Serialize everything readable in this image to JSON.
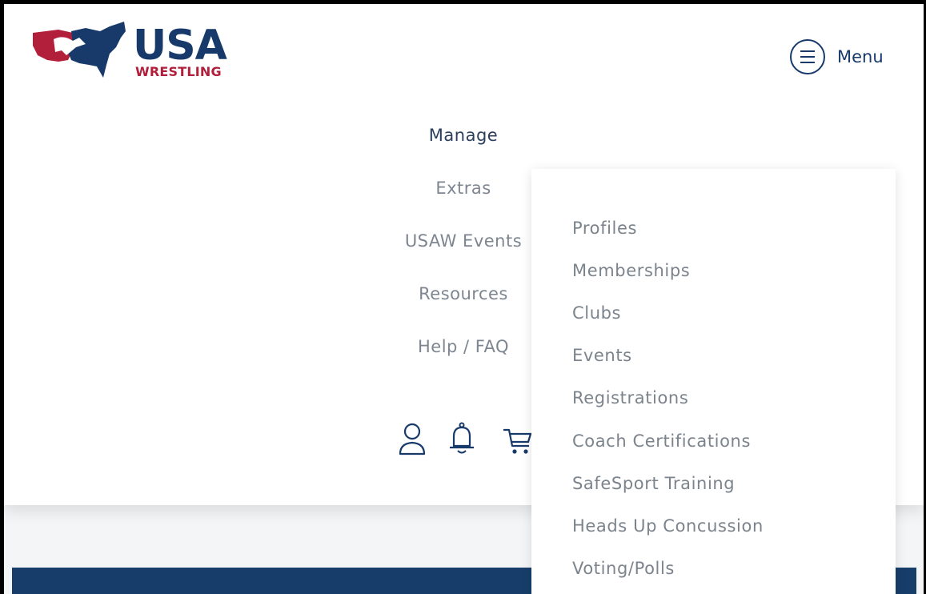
{
  "logo": {
    "usa": "USA",
    "wrestling": "WRESTLING"
  },
  "menu_toggle": {
    "label": "Menu"
  },
  "nav": [
    {
      "label": "Manage"
    },
    {
      "label": "Extras"
    },
    {
      "label": "USAW Events"
    },
    {
      "label": "Resources"
    },
    {
      "label": "Help / FAQ"
    }
  ],
  "icons": [
    "user-icon",
    "bell-icon",
    "cart-icon"
  ],
  "dropdown": [
    {
      "label": "Profiles"
    },
    {
      "label": "Memberships"
    },
    {
      "label": "Clubs"
    },
    {
      "label": "Events"
    },
    {
      "label": "Registrations"
    },
    {
      "label": "Coach Certifications"
    },
    {
      "label": "SafeSport Training"
    },
    {
      "label": "Heads Up Concussion"
    },
    {
      "label": "Voting/Polls"
    }
  ],
  "colors": {
    "navy": "#173a6b",
    "red": "#b21f3a",
    "text_gray": "#7b838c",
    "bottom_bar": "#173e6a"
  }
}
